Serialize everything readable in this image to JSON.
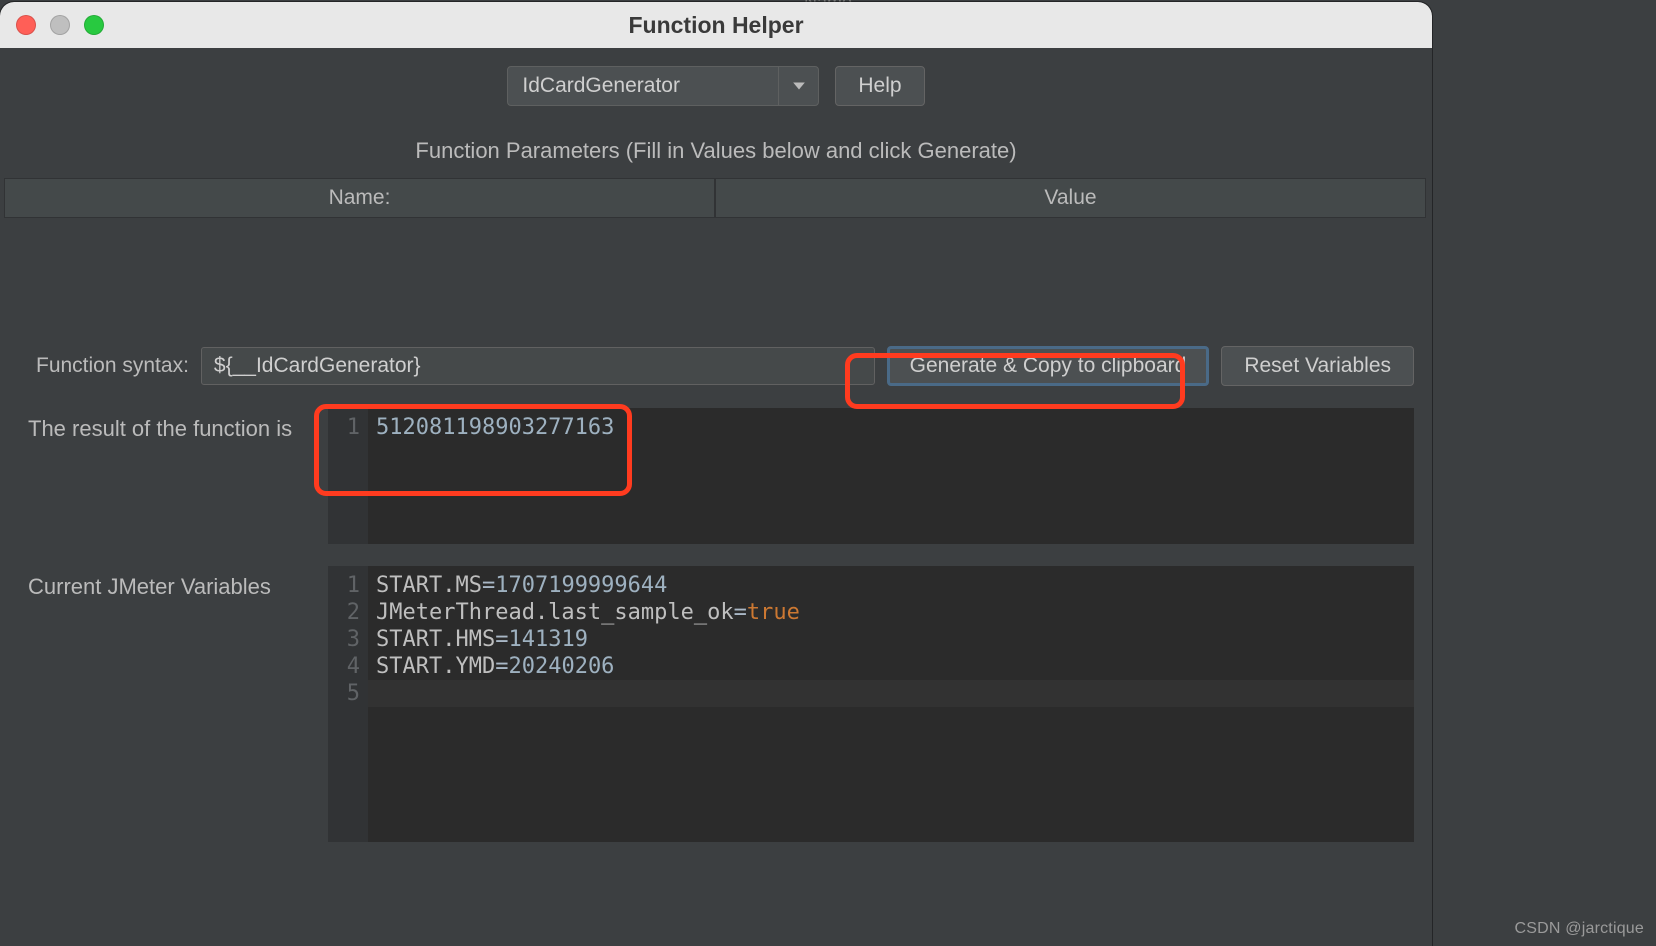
{
  "bg_hint": "Name",
  "titlebar": {
    "title": "Function Helper"
  },
  "toolbar": {
    "function_selected": "IdCardGenerator",
    "help_label": "Help"
  },
  "params": {
    "section_label": "Function Parameters (Fill in Values below and click Generate)",
    "col_name": "Name:",
    "col_value": "Value"
  },
  "syntax": {
    "label": "Function syntax:",
    "value": "${__IdCardGenerator}",
    "generate_label": "Generate & Copy to clipboard",
    "reset_label": "Reset Variables"
  },
  "result": {
    "label": "The result of the function is",
    "lines": [
      {
        "n": "1",
        "value": "512081198903277163"
      }
    ]
  },
  "vars": {
    "label": "Current JMeter Variables",
    "lines": [
      {
        "n": "1",
        "key": "START.MS",
        "val": "1707199999644",
        "type": "num"
      },
      {
        "n": "2",
        "key": "JMeterThread.last_sample_ok",
        "val": "true",
        "type": "bool"
      },
      {
        "n": "3",
        "key": "START.HMS",
        "val": "141319",
        "type": "num"
      },
      {
        "n": "4",
        "key": "START.YMD",
        "val": "20240206",
        "type": "num"
      },
      {
        "n": "5",
        "key": "",
        "val": "",
        "type": ""
      }
    ]
  },
  "watermark": "CSDN @jarctique"
}
